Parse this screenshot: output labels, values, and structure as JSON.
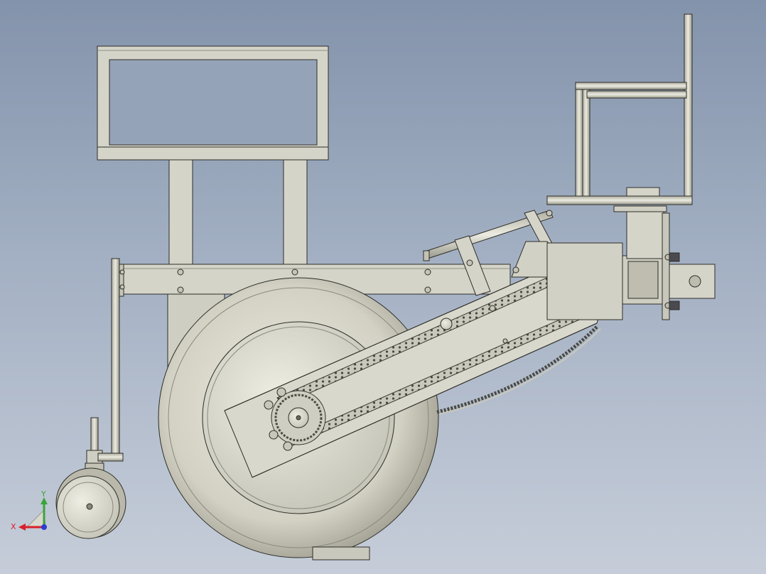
{
  "triad": {
    "x_label": "X",
    "y_label": "Y",
    "x_color": "#d8202a",
    "y_color": "#3aa53a",
    "z_color": "#2a3fd0"
  },
  "colors": {
    "background_top": "#8393ab",
    "background_bottom": "#c6cdd9",
    "part_fill": "#d5d4c9",
    "part_shade": "#b4b3a6",
    "outline": "#2e2e28"
  }
}
